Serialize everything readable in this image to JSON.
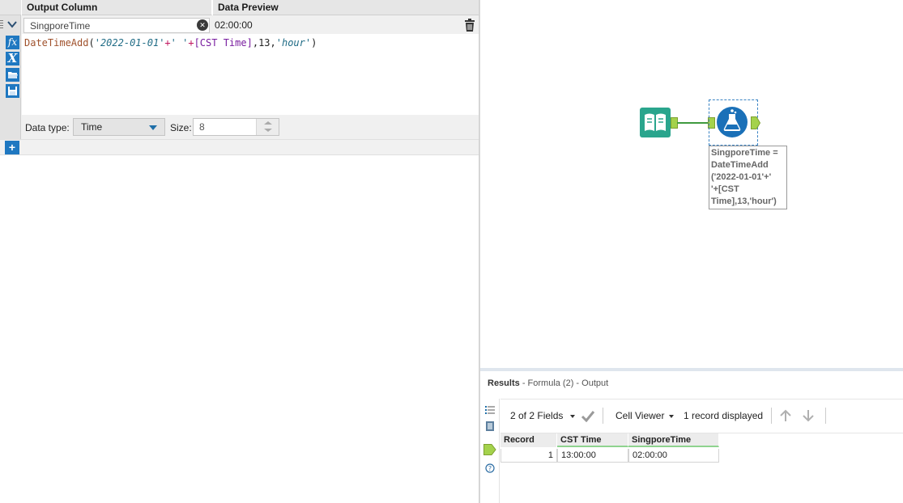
{
  "formula_panel": {
    "headers": {
      "output_column": "Output Column",
      "data_preview": "Data Preview"
    },
    "row": {
      "output_column_value": "SingporeTime",
      "data_preview_value": "02:00:00",
      "expression": {
        "fn": "DateTimeAdd",
        "open_paren": "(",
        "str1": "'2022-01-01'",
        "plus1": "+",
        "str2": "' '",
        "plus2": "+",
        "field": "[CST Time]",
        "comma1": ",",
        "number": "13",
        "comma2": ",",
        "str3": "'hour'",
        "close_paren": ")"
      },
      "data_type_label": "Data type:",
      "data_type_value": "Time",
      "size_label": "Size:",
      "size_value": "8"
    },
    "icons": [
      "fx-function-icon",
      "variable-x-icon",
      "open-folder-icon",
      "save-disk-icon"
    ],
    "add_button": "+"
  },
  "canvas": {
    "annotation_lines": [
      "SingporeTime =",
      "DateTimeAdd",
      "('2022-01-01'+'",
      "'+[CST",
      "Time],13,'hour')"
    ]
  },
  "results": {
    "title": "Results",
    "subtitle": "- Formula (2) - Output",
    "fields_label": "2 of 2 Fields",
    "cell_viewer_label": "Cell Viewer",
    "records_label": "1 record displayed",
    "columns": [
      "Record",
      "CST Time",
      "SingporeTime"
    ],
    "rows": [
      {
        "record": "1",
        "cst_time": "13:00:00",
        "singapore_time": "02:00:00"
      }
    ]
  },
  "colors": {
    "accent_blue": "#1f78c1",
    "anchor_green": "#a4d24c",
    "connection_green": "#3f9a3f"
  }
}
